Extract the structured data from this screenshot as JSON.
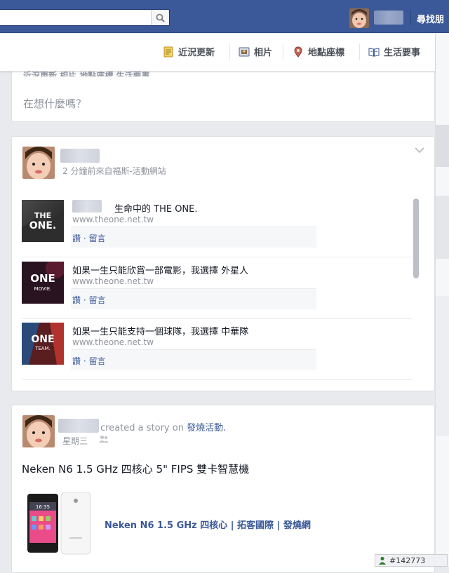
{
  "topbar": {
    "find_friends": "尋找朋",
    "search_placeholder": ""
  },
  "tabs": [
    {
      "label": "近況更新",
      "icon": "status-icon"
    },
    {
      "label": "相片",
      "icon": "photo-icon"
    },
    {
      "label": "地點座標",
      "icon": "place-pin-icon"
    },
    {
      "label": "生活要事",
      "icon": "life-event-icon"
    }
  ],
  "composer": {
    "ghost_tabs": "近況更新    相片    地點座標    生活要事",
    "placeholder": "在想什麼嗎？"
  },
  "post1": {
    "meta": "2 分鐘前來自福斯-活動網站",
    "stories": [
      {
        "title": "生命中的 THE ONE.",
        "domain": "www.theone.net.tw",
        "actions": "讚 · 留言",
        "thumb_text": "THE\nONE."
      },
      {
        "title": "如果一生只能欣賞一部電影，我選擇 外星人",
        "domain": "www.theone.net.tw",
        "actions": "讚 · 留言",
        "thumb_text": "ONE\nMOVIE."
      },
      {
        "title": "如果一生只能支持一個球隊，我選擇 中華隊",
        "domain": "www.theone.net.tw",
        "actions": "讚 · 留言",
        "thumb_text": "ONE\nTEAM."
      }
    ]
  },
  "post2": {
    "action_text": "created a story on",
    "action_target": "發燒活動.",
    "meta": "星期三",
    "text": "Neken N6 1.5 GHz 四核心 5\" FIPS 雙卡智慧機",
    "product_title": "Neken N6 1.5 GHz 四核心 | 拓客國際 | 發燒網",
    "phone_time": "16:35"
  },
  "badge": {
    "text": "#142773"
  },
  "colors": {
    "brand": "#3b5998",
    "background": "#e9eaed"
  }
}
